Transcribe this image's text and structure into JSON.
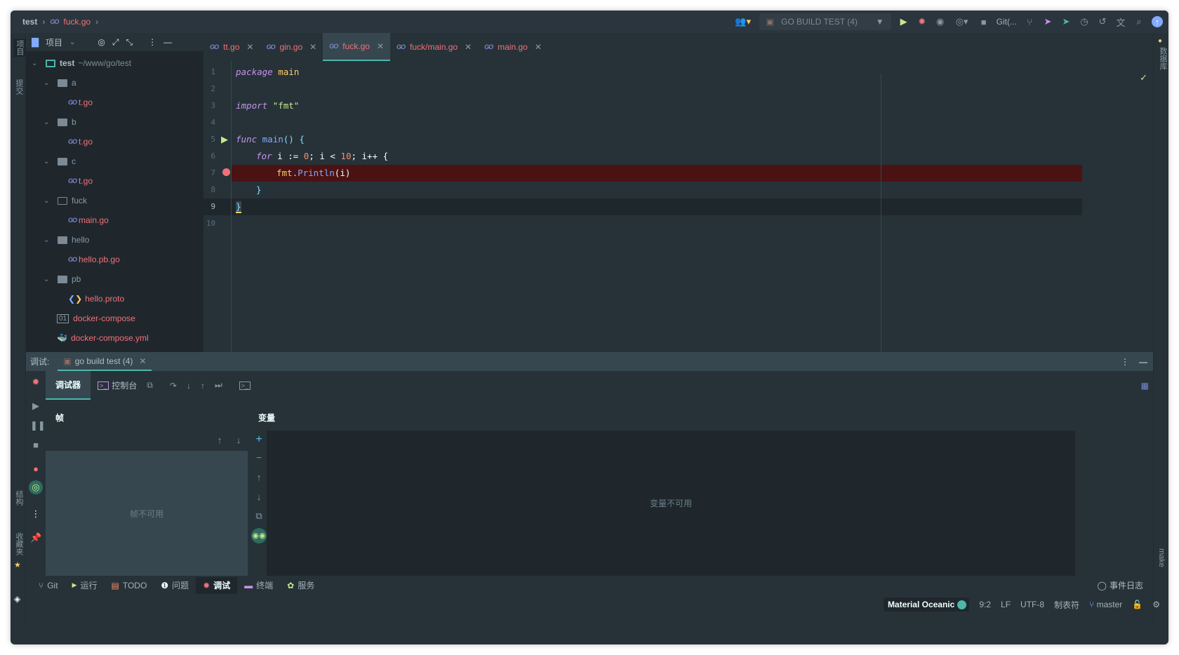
{
  "breadcrumb": {
    "project": "test",
    "file": "fuck.go",
    "go_icon": "GO"
  },
  "toolbar": {
    "run_config": "GO BUILD TEST (4)",
    "git_label": "Git(...",
    "icons": [
      "users-icon",
      "run-config-icon",
      "run-icon",
      "debug-icon",
      "coverage-icon",
      "profile-icon",
      "stop-icon",
      "git-branch-icon",
      "git-push-icon",
      "git-commit-icon",
      "history-icon",
      "rollback-icon",
      "translate-icon",
      "search-icon",
      "update-icon"
    ]
  },
  "left_stripe": {
    "project": "项目",
    "commit": "提交",
    "structure": "结构",
    "favorites": "收藏夹"
  },
  "right_stripe": {
    "database": "数据库",
    "make": "make"
  },
  "project_panel": {
    "title": "项目",
    "root": {
      "name": "test",
      "path": "~/www/go/test"
    },
    "items": [
      {
        "type": "dir",
        "name": "a"
      },
      {
        "type": "go",
        "name": "t.go"
      },
      {
        "type": "dir",
        "name": "b"
      },
      {
        "type": "go",
        "name": "t.go"
      },
      {
        "type": "dir",
        "name": "c"
      },
      {
        "type": "go",
        "name": "t.go"
      },
      {
        "type": "dir-open",
        "name": "fuck"
      },
      {
        "type": "go",
        "name": "main.go"
      },
      {
        "type": "dir",
        "name": "hello"
      },
      {
        "type": "go",
        "name": "hello.pb.go"
      },
      {
        "type": "dir",
        "name": "pb"
      },
      {
        "type": "proto",
        "name": "hello.proto"
      },
      {
        "type": "bin",
        "name": "docker-compose"
      },
      {
        "type": "docker",
        "name": "docker-compose.yml"
      }
    ]
  },
  "editor": {
    "tabs": [
      {
        "label": "tt.go",
        "active": false
      },
      {
        "label": "gin.go",
        "active": false
      },
      {
        "label": "fuck.go",
        "active": true
      },
      {
        "label": "fuck/main.go",
        "active": false
      },
      {
        "label": "main.go",
        "active": false
      }
    ],
    "line_numbers": [
      "1",
      "2",
      "3",
      "4",
      "5",
      "6",
      "7",
      "8",
      "9",
      "10"
    ],
    "code": {
      "l1_kw": "package",
      "l1_name": "main",
      "l3_kw": "import",
      "l3_str": "\"fmt\"",
      "l5_kw": "func",
      "l5_fn": "main",
      "l5_rest": "() {",
      "l6_kw": "for",
      "l6_a": " i := ",
      "l6_n0": "0",
      "l6_b": "; i < ",
      "l6_n10": "10",
      "l6_c": "; i++ {",
      "l7_pkg": "fmt",
      "l7_dot": ".",
      "l7_fn": "Println",
      "l7_args": "(i)",
      "l8": "}",
      "l9": "}"
    },
    "breakpoint_line": 7,
    "caret_line": 9
  },
  "debug": {
    "label": "调试:",
    "session_tab": "go build test (4)",
    "tabs": {
      "debugger": "调试器",
      "console": "控制台"
    },
    "frames_label": "帧",
    "variables_label": "变量",
    "frames_empty": "帧不可用",
    "variables_empty": "变量不可用"
  },
  "bottom_tabs": [
    {
      "label": "Git",
      "icon": "git-branch-icon",
      "active": false
    },
    {
      "label": "运行",
      "icon": "run-icon",
      "active": false
    },
    {
      "label": "TODO",
      "icon": "todo-icon",
      "active": false
    },
    {
      "label": "问题",
      "icon": "problems-icon",
      "active": false
    },
    {
      "label": "调试",
      "icon": "debug-icon",
      "active": true
    },
    {
      "label": "终端",
      "icon": "terminal-icon",
      "active": false
    },
    {
      "label": "服务",
      "icon": "services-icon",
      "active": false
    }
  ],
  "event_log": "事件日志",
  "status": {
    "theme": "Material Oceanic",
    "position": "9:2",
    "line_sep": "LF",
    "encoding": "UTF-8",
    "indent": "制表符",
    "branch": "master"
  },
  "colors": {
    "accent": "#4db6ac",
    "breakpoint_line": "#4b1214",
    "file_modified": "#f07178",
    "background": "#263238"
  }
}
